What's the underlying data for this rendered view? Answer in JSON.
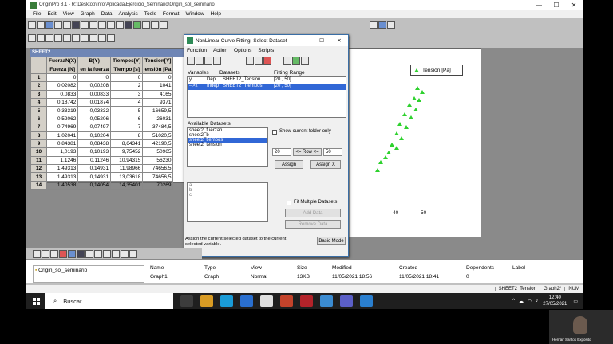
{
  "window": {
    "title": "OriginPro 8.1 - R:\\Desktop\\InforAplicada\\Ejercicio_Seminario\\Origin_sol_seminario",
    "min": "—",
    "max": "☐",
    "close": "✕"
  },
  "menu": [
    "File",
    "Edit",
    "View",
    "Graph",
    "Data",
    "Analysis",
    "Tools",
    "Format",
    "Window",
    "Help"
  ],
  "worksheet": {
    "title": "SHEET2",
    "columns": [
      "FuerzaN(X)",
      "B(Y)",
      "Tiempos[Y]",
      "Tension[Y]"
    ],
    "longnames": [
      "Fuerza [N]",
      "en la fuerza",
      "Tiempo [s]",
      "ensión [Pa"
    ],
    "rows": [
      [
        "1",
        "0",
        "0",
        "0",
        "0"
      ],
      [
        "2",
        "0,02082",
        "0,00208",
        "2",
        "1041"
      ],
      [
        "3",
        "0,0833",
        "0,00833",
        "3",
        "4165"
      ],
      [
        "4",
        "0,18742",
        "0,01874",
        "4",
        "9371"
      ],
      [
        "5",
        "0,33319",
        "0,03332",
        "5",
        "16659,5"
      ],
      [
        "6",
        "0,52062",
        "0,05206",
        "6",
        "26031"
      ],
      [
        "7",
        "0,74969",
        "0,07497",
        "7",
        "37484,5"
      ],
      [
        "8",
        "1,02041",
        "0,10204",
        "8",
        "51020,5"
      ],
      [
        "9",
        "0,84381",
        "0,08438",
        "8,64341",
        "42190,5"
      ],
      [
        "10",
        "1,0193",
        "0,10193",
        "9,75452",
        "50965"
      ],
      [
        "11",
        "1,1246",
        "0,11246",
        "10,94315",
        "56230"
      ],
      [
        "12",
        "1,49313",
        "0,14931",
        "11,98966",
        "74656,5"
      ],
      [
        "13",
        "1,49313",
        "0,14931",
        "13,03618",
        "74656,5"
      ],
      [
        "14",
        "1,40538",
        "0,14054",
        "14,35401",
        "70269"
      ]
    ]
  },
  "dialog": {
    "title": "NonLinear Curve Fitting: Select Dataset",
    "min": "—",
    "max": "☐",
    "close": "✕",
    "menu": [
      "Function",
      "Action",
      "Options",
      "Scripts"
    ],
    "headers": [
      "Variables",
      "Datasets",
      "Fitting Range"
    ],
    "vars": [
      {
        "a": "y",
        "b": "Dep",
        "c": "SHEET2_Tension",
        "d": "[20 , 50]"
      },
      {
        "a": "-->x",
        "b": "Indep",
        "c": "SHEET2_Tiempos",
        "d": "[20 , 50]"
      }
    ],
    "available_label": "Available Datasets",
    "datasets": [
      "sheet2_fuerzan",
      "sheet2_b",
      "sheet2_tiempos",
      "sheet2_tension"
    ],
    "show_folder": "Show current folder only",
    "row_from": "20",
    "row_label": "<= Row <=",
    "row_to": "50",
    "assign": "Assign",
    "assign_x": "Assign X",
    "sub_items": [
      "a",
      "b",
      "c"
    ],
    "fit_multiple": "Fit Multiple Datasets",
    "add_data": "Add Data",
    "remove_data": "Remove Data",
    "hint": "Assign the current selected dataset to the current selected variable.",
    "basic_mode": "Basic Mode"
  },
  "graph": {
    "legend": "Tensión [Pa]",
    "tick_40": "40",
    "tick_50": "50"
  },
  "project": {
    "folder": "Origin_sol_seminario",
    "headers": [
      "Name",
      "Type",
      "View",
      "Size",
      "Modified",
      "Created",
      "Dependents",
      "Label"
    ],
    "row": [
      "Graph1",
      "Graph",
      "Normal",
      "13KB",
      "11/05/2021 18:56",
      "11/05/2021 18:41",
      "0",
      ""
    ]
  },
  "status": [
    "SHEET2_Tension",
    "Graph2*",
    "NUM"
  ],
  "taskbar": {
    "search": "Buscar",
    "time": "12:40",
    "date": "27/05/2021"
  },
  "webcam": {
    "name": "Hernán Santos Expósito"
  }
}
